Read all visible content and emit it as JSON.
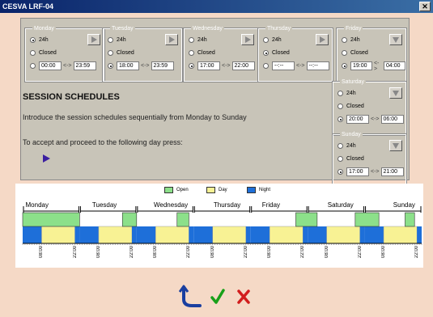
{
  "window": {
    "title": "CESVA LRF-04",
    "close_label": "✕"
  },
  "days": [
    {
      "name": "Monday",
      "mode": "24h",
      "from": "00:00",
      "to": "23:59"
    },
    {
      "name": "Tuesday",
      "mode": "custom",
      "from": "18:00",
      "to": "23:59"
    },
    {
      "name": "Wednesday",
      "mode": "custom",
      "from": "17:00",
      "to": "22:00"
    },
    {
      "name": "Thursday",
      "mode": "closed",
      "from": "--:--",
      "to": "--:--"
    },
    {
      "name": "Friday",
      "mode": "custom",
      "from": "19:00",
      "to": "04:00"
    },
    {
      "name": "Saturday",
      "mode": "custom",
      "from": "20:00",
      "to": "06:00"
    },
    {
      "name": "Sunday",
      "mode": "custom",
      "from": "17:00",
      "to": "21:00"
    }
  ],
  "options": {
    "h24": "24h",
    "closed": "Closed",
    "range_sep": "<->"
  },
  "instructions": {
    "title": "SESSION SCHEDULES",
    "line1": "Introduce the session schedules sequentially from Monday to Sunday",
    "line2": "To accept and proceed to the following day press:"
  },
  "chart_legend": {
    "open": "Open",
    "day": "Day",
    "night": "Night"
  },
  "chart_data": {
    "type": "timeline",
    "categories": [
      "Monday",
      "Tuesday",
      "Wednesday",
      "Thursday",
      "Friday",
      "Saturday",
      "Sunday"
    ],
    "tick_labels": [
      "08:00",
      "22:00"
    ],
    "open_periods": [
      {
        "day": "Monday",
        "from": "00:00",
        "to": "23:59"
      },
      {
        "day": "Tuesday",
        "from": "18:00",
        "to": "23:59"
      },
      {
        "day": "Wednesday",
        "from": "17:00",
        "to": "22:00"
      },
      {
        "day": "Friday",
        "from": "19:00",
        "to": "04:00"
      },
      {
        "day": "Saturday",
        "from": "20:00",
        "to": "06:00"
      },
      {
        "day": "Sunday",
        "from": "17:00",
        "to": "21:00"
      }
    ],
    "day_period": {
      "from": "08:00",
      "to": "22:00"
    },
    "night_period": {
      "from": "22:00",
      "to": "08:00"
    }
  },
  "colors": {
    "open": "#8ce08a",
    "day": "#f8f294",
    "night": "#1e6fd9",
    "accept": "#19a019",
    "cancel": "#d21d1d",
    "back": "#1a3fa0"
  }
}
